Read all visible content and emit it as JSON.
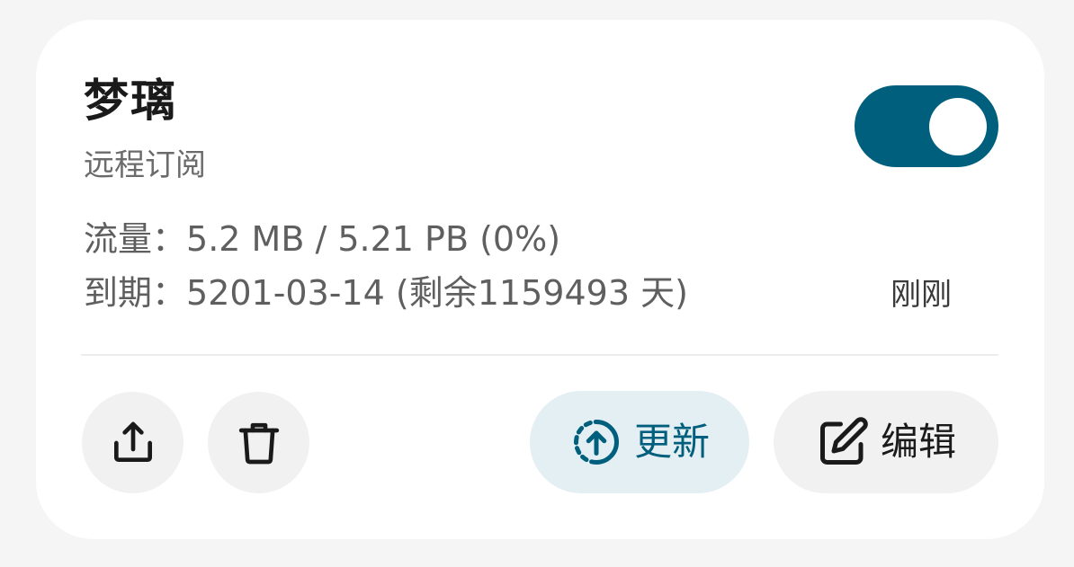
{
  "subscription": {
    "name": "梦璃",
    "type": "远程订阅",
    "enabled": true,
    "traffic_label": "流量：",
    "traffic_value": "5.2 MB / 5.21 PB (0%)",
    "expire_label": "到期：",
    "expire_value": "5201-03-14 (剩余1159493 天)",
    "updated": "刚刚"
  },
  "actions": {
    "share_icon": "share-icon",
    "delete_icon": "trash-icon",
    "update_label": "更新",
    "update_icon": "upload-refresh-icon",
    "edit_label": "编辑",
    "edit_icon": "edit-icon"
  },
  "colors": {
    "accent": "#005f7d",
    "accent_light": "#e4eff3",
    "card_bg": "#ffffff",
    "page_bg": "#f5f5f5"
  }
}
